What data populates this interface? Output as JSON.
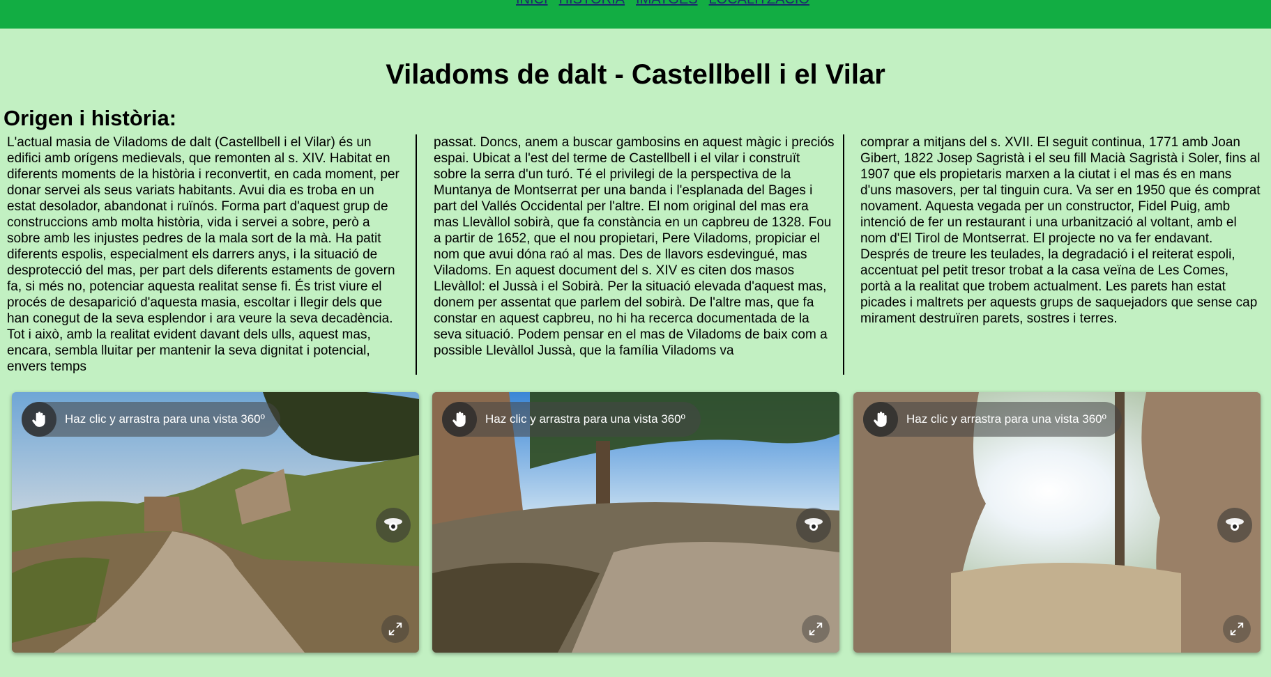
{
  "nav": {
    "items": [
      {
        "label": "INICI"
      },
      {
        "label": "HISTÒRIA"
      },
      {
        "label": "IMATGES"
      },
      {
        "label": "LOCALITZACIÓ"
      }
    ]
  },
  "page_title": "Viladoms de dalt - Castellbell i el Vilar",
  "section_title": "Origen i història:",
  "article": {
    "col1": "L'actual masia de Viladoms de dalt (Castellbell i el Vilar) és un edifici amb orígens medievals, que remonten al s. XIV. Habitat en diferents moments de la història i reconvertit, en cada moment, per donar servei als seus variats habitants. Avui dia es troba en un estat desolador, abandonat i ruïnós. Forma part d'aquest grup de construccions amb molta història, vida i servei a sobre, però a sobre amb les injustes pedres de la mala sort de la mà. Ha patit diferents espolis, especialment els darrers anys, i la situació de desprotecció del mas, per part dels diferents estaments de govern fa, si més no, potenciar aquesta realitat sense fi. És trist viure el procés de desaparició d'aquesta masia, escoltar i llegir dels que han conegut de la seva esplendor i ara veure la seva decadència. Tot i això, amb la realitat evident davant dels ulls, aquest mas, encara, sembla lluitar per mantenir la seva dignitat i potencial, envers temps",
    "col2": "passat. Doncs, anem a buscar gambosins en aquest màgic i preciós espai. Ubicat a l'est del terme de Castellbell i el vilar i construït sobre la serra d'un turó. Té el privilegi de la perspectiva de la Muntanya de Montserrat per una banda i l'esplanada del Bages i part del Vallés Occidental per l'altre. El nom original del mas era mas Llevàllol sobirà, que fa constància en un capbreu de 1328. Fou a partir de 1652, que el nou propietari, Pere Viladoms, propiciar el nom que avui dóna raó al mas. Des de llavors esdevingué, mas Viladoms. En aquest document del s. XIV es citen dos masos Llevàllol: el Jussà i el Sobirà. Per la situació elevada d'aquest mas, donem per assentat que parlem del sobirà. De l'altre mas, que fa constar en aquest capbreu, no hi ha recerca documentada de la seva situació. Podem pensar en el mas de Viladoms de baix com a possible Llevàllol Jussà, que la família Viladoms va",
    "col3": "comprar a mitjans del s. XVII. El seguit continua, 1771 amb Joan Gibert, 1822 Josep Sagristà i el seu fill Macià Sagristà i Soler, fins al 1907 que els propietaris marxen a la ciutat i el mas és en mans d'uns masovers, per tal tinguin cura. Va ser en 1950 que és comprat novament. Aquesta vegada per un constructor, Fidel Puig, amb intenció de fer un restaurant i una urbanització al voltant, amb el nom d'El Tirol de Montserrat. El projecte no va fer endavant. Després de treure les teulades, la degradació i el reiterat espoli, accentuat pel petit tresor trobat a la casa veïna de Les Comes, portà a la realitat que trobem actualment. Les parets han estat picades i maltrets per aquests grups de saquejadors que sense cap mirament destruïren parets, sostres i terres."
  },
  "panoramas": [
    {
      "hint": "Haz clic y arrastra para una vista 360º"
    },
    {
      "hint": "Haz clic y arrastra para una vista 360º"
    },
    {
      "hint": "Haz clic y arrastra para una vista 360º"
    }
  ],
  "colors": {
    "background": "#c2f0c2",
    "topbar": "#12ad43",
    "nav_link": "#1a2a6c"
  },
  "icons": {
    "hint": "hand-drag-icon",
    "gyro": "gyroscope-icon",
    "fullscreen": "fullscreen-icon"
  }
}
